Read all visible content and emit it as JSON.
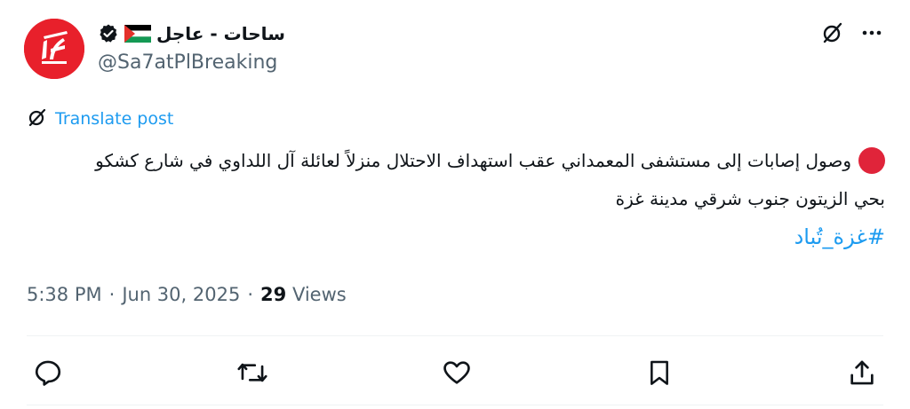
{
  "author": {
    "display_name": "ساحات - عاجل",
    "handle": "@Sa7atPlBreaking",
    "flag_icon": "palestine-flag-icon",
    "verified_icon": "verified-badge-icon",
    "avatar_icon": "sa7at-logo-icon"
  },
  "header_actions": {
    "grok_icon": "grok-icon",
    "more_icon": "more-horizontal-icon"
  },
  "translate": {
    "label": "Translate post",
    "icon": "translate-icon"
  },
  "post": {
    "line1": "وصول إصابات إلى مستشفى المعمداني عقب استهداف الاحتلال منزلاً لعائلة آل اللداوي في شارع كشكو",
    "line2": "بحي الزيتون جنوب شرقي مدينة غزة",
    "hashtag": "#غزة_تُباد",
    "leading_icon": "red-circle-emoji"
  },
  "meta": {
    "time": "5:38 PM",
    "separator1": "·",
    "date": "Jun 30, 2025",
    "separator2": "·",
    "views_count": "29",
    "views_label": "Views"
  },
  "actions": [
    "reply-icon",
    "repost-icon",
    "like-icon",
    "bookmark-icon",
    "share-icon"
  ],
  "colors": {
    "accent": "#1d9bf0",
    "muted": "#536471",
    "text": "#0f1419",
    "avatar_red": "#e8202b",
    "divider": "#eff3f4"
  }
}
